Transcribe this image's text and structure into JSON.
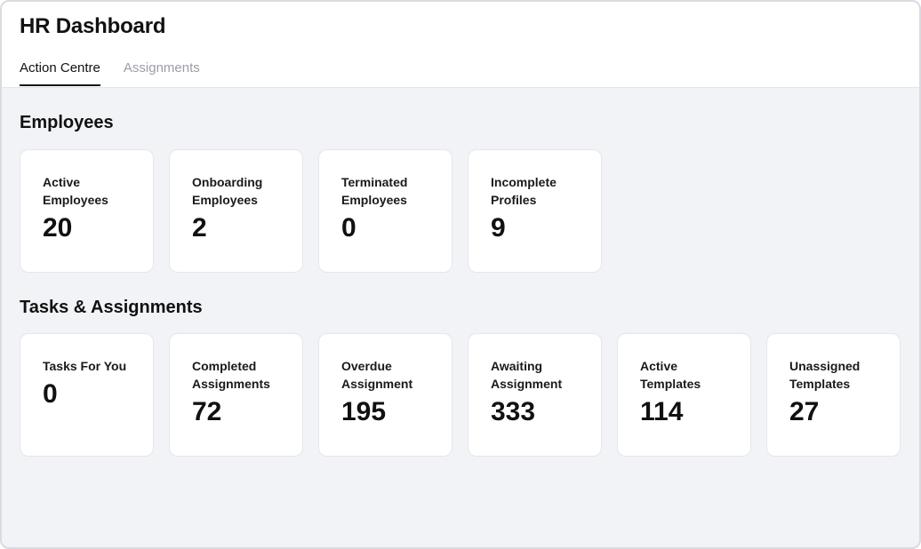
{
  "header": {
    "title": "HR Dashboard",
    "tabs": [
      {
        "label": "Action Centre",
        "active": true
      },
      {
        "label": "Assignments",
        "active": false
      }
    ]
  },
  "employees": {
    "title": "Employees",
    "cards": [
      {
        "label": "Active\nEmployees",
        "value": "20"
      },
      {
        "label": "Onboarding\nEmployees",
        "value": "2"
      },
      {
        "label": "Terminated\nEmployees",
        "value": "0"
      },
      {
        "label": "Incomplete\nProfiles",
        "value": "9"
      }
    ]
  },
  "tasks": {
    "title": "Tasks & Assignments",
    "cards": [
      {
        "label": "Tasks For You",
        "value": "0"
      },
      {
        "label": "Completed\nAssignments",
        "value": "72"
      },
      {
        "label": "Overdue\nAssignment",
        "value": "195"
      },
      {
        "label": "Awaiting\nAssignment",
        "value": "333"
      },
      {
        "label": "Active\nTemplates",
        "value": "114"
      },
      {
        "label": "Unassigned\nTemplates",
        "value": "27"
      }
    ]
  }
}
